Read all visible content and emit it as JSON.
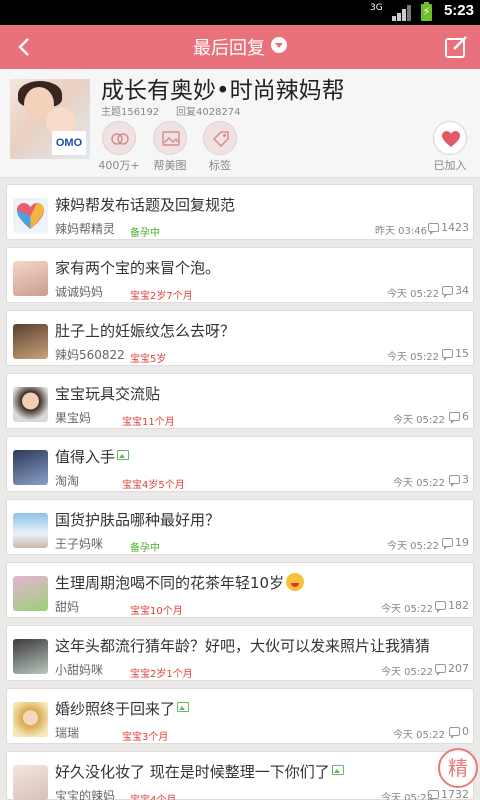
{
  "status_bar": {
    "network": "3G",
    "time": "5:23"
  },
  "titlebar": {
    "title": "最后回复"
  },
  "forum": {
    "name": "成长有奥妙•时尚辣妈帮",
    "topic_count": "主题156192",
    "reply_count": "回复4028274",
    "avatar_logo": "OMO",
    "actions": [
      {
        "label": "400万+",
        "icon": "members-icon"
      },
      {
        "label": "帮美图",
        "icon": "image-icon"
      },
      {
        "label": "标签",
        "icon": "tag-icon"
      }
    ],
    "joined_label": "已加入"
  },
  "colors": {
    "accent": "#e9717b",
    "badge_green": "#4caf2a",
    "badge_red": "#e0403a"
  },
  "topics": [
    {
      "title": "辣妈帮发布话题及回复规范",
      "author": "辣妈帮精灵",
      "badge": "备孕中",
      "time": "昨天 03:46",
      "count": "1423",
      "has_image": false,
      "has_emoji": false
    },
    {
      "title": "家有两个宝的来冒个泡。",
      "author": "诚诚妈妈",
      "badge": "宝宝2岁7个月",
      "time": "今天 05:22",
      "count": "34",
      "has_image": false,
      "has_emoji": false
    },
    {
      "title": "肚子上的妊娠纹怎么去呀？",
      "author": "辣妈560822",
      "badge": "宝宝5岁",
      "time": "今天 05:22",
      "count": "15",
      "has_image": false,
      "has_emoji": false
    },
    {
      "title": "宝宝玩具交流贴",
      "author": "果宝妈",
      "badge": "宝宝11个月",
      "time": "今天 05:22",
      "count": "6",
      "has_image": false,
      "has_emoji": false
    },
    {
      "title": "值得入手",
      "author": "淘淘",
      "badge": "宝宝4岁5个月",
      "time": "今天 05:22",
      "count": "3",
      "has_image": true,
      "has_emoji": false
    },
    {
      "title": "国货护肤品哪种最好用？",
      "author": "王子妈咪",
      "badge": "备孕中",
      "time": "今天 05:22",
      "count": "19",
      "has_image": false,
      "has_emoji": false
    },
    {
      "title": "生理周期泡喝不同的花茶年轻10岁",
      "author": "甜妈",
      "badge": "宝宝10个月",
      "time": "今天 05:22",
      "count": "182",
      "has_image": false,
      "has_emoji": true
    },
    {
      "title": "这年头都流行猜年龄？好吧，大伙可以发来照片让我猜猜",
      "author": "小甜妈咪",
      "badge": "宝宝2岁1个月",
      "time": "今天 05:22",
      "count": "207",
      "has_image": false,
      "has_emoji": false
    },
    {
      "title": "婚纱照终于回来了",
      "author": "瑞瑞",
      "badge": "宝宝3个月",
      "time": "今天 05:22",
      "count": "0",
      "has_image": true,
      "has_emoji": false
    },
    {
      "title": "好久没化妆了 现在是时候整理一下你们了",
      "author": "宝宝的辣妈",
      "badge": "宝宝4个月",
      "time": "今天 05:22",
      "count": "1732",
      "has_image": true,
      "has_emoji": false
    }
  ],
  "essence_stamp": "精"
}
